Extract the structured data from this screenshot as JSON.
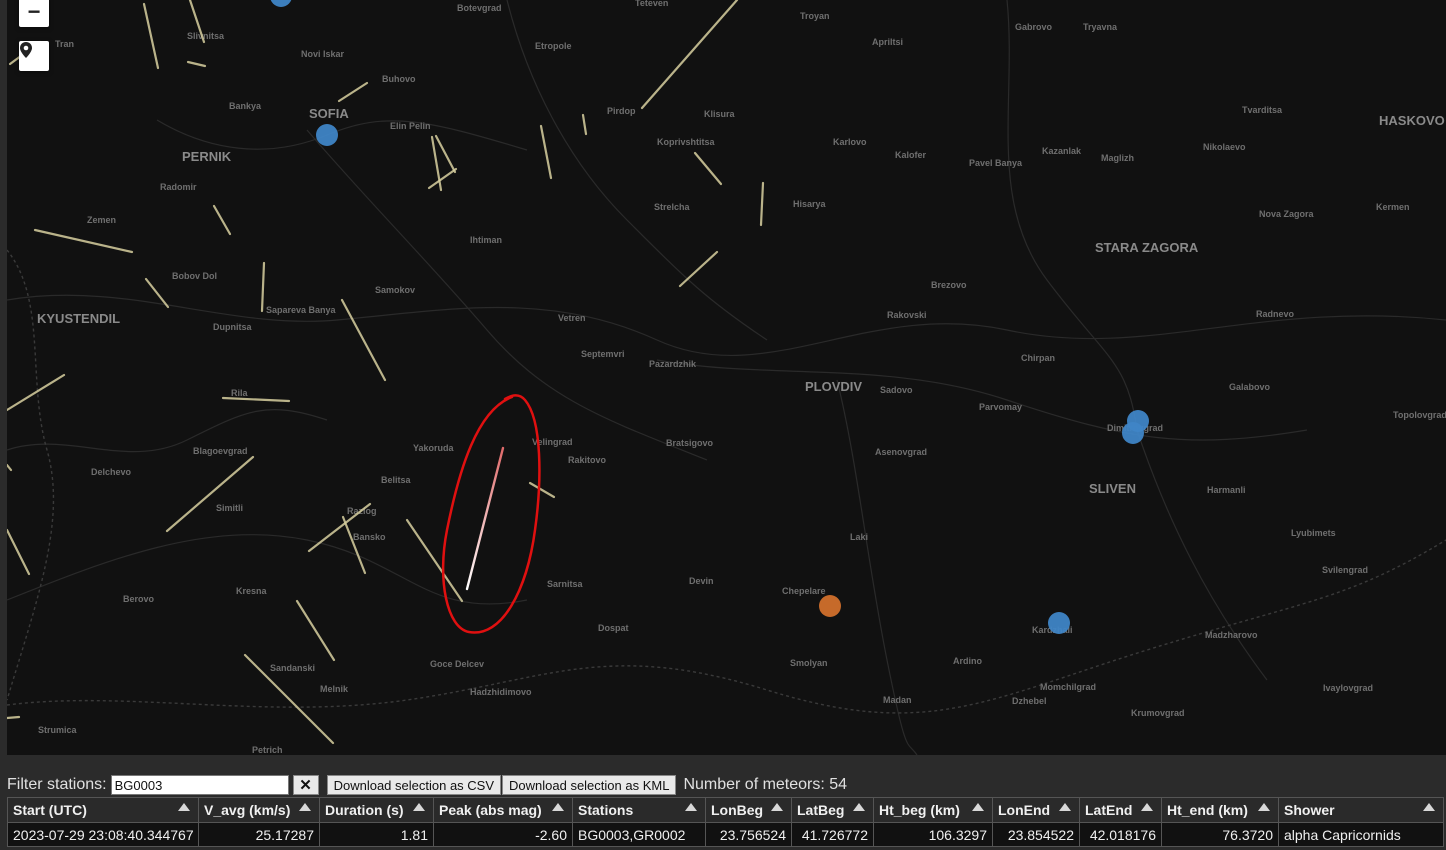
{
  "map": {
    "labels_big": [
      {
        "text": "SOFIA"
      },
      {
        "text": "KYUSTENDIL"
      },
      {
        "text": "PERNIK"
      },
      {
        "text": "PLOVDIV"
      },
      {
        "text": "STARA ZAGORA"
      },
      {
        "text": "HASKOVO"
      },
      {
        "text": "SLIVEN"
      }
    ],
    "labels_small": [
      "Botevgrad",
      "Teteven",
      "Troyan",
      "Gabrovo",
      "Tryavna",
      "Apriltsi",
      "Etropole",
      "Novi Iskar",
      "Buhovo",
      "Bankya",
      "Elin Pelin",
      "Pirdop",
      "Klisura",
      "Koprivshtitsa",
      "Karlovo",
      "Kalofer",
      "Pavel Banya",
      "Kazanlak",
      "Maglizh",
      "Nikolaevo",
      "Tvarditsa",
      "Radomir",
      "Zemen",
      "Strelcha",
      "Hisarya",
      "Nova Zagora",
      "Kermen",
      "Ihtiman",
      "Bobov Dol",
      "Samokov",
      "Brezovo",
      "Sapareva Banya",
      "Dupnitsa",
      "Vetren",
      "Rakovski",
      "Radnevo",
      "Septemvri",
      "Pazardzhik",
      "Chirpan",
      "Rila",
      "Sadovo",
      "Parvomay",
      "Galabovo",
      "Topolovgrad",
      "Yakoruda",
      "Velingrad",
      "Bratsigovo",
      "Asenovgrad",
      "Dimitrovgrad",
      "Delchevo",
      "Blagoevgrad",
      "Rakitovo",
      "Belitsa",
      "Harmanli",
      "Simitli",
      "Razlog",
      "Bansko",
      "Laki",
      "Lyubimets",
      "Svilengrad",
      "Kresna",
      "Sarnitsa",
      "Devin",
      "Chepelare",
      "Berovo",
      "Dospat",
      "Kardzhali",
      "Madzharovo",
      "Smolyan",
      "Sandanski",
      "Ardino",
      "Goce Delcev",
      "Momchilgrad",
      "Ivaylovgrad",
      "Melnik",
      "Hadzhidimovo",
      "Madan",
      "Dzhebel",
      "Krumovgrad",
      "Strumica",
      "Petrich",
      "Tran",
      "Slivnitsa"
    ],
    "station_colors": {
      "network": "#3f85c6",
      "selected": "#c66a2a"
    },
    "meteor_color": "#d8d0a0",
    "highlight_color": "#e01010"
  },
  "controls": {
    "zoom_out": "−"
  },
  "filter": {
    "label": "Filter stations:",
    "value": "BG0003",
    "clear": "✕",
    "csv_button": "Download selection as CSV",
    "kml_button": "Download selection as KML",
    "count_text": "Number of meteors: 54"
  },
  "table": {
    "columns": [
      "Start (UTC)",
      "V_avg (km/s)",
      "Duration (s)",
      "Peak (abs mag)",
      "Stations",
      "LonBeg",
      "LatBeg",
      "Ht_beg (km)",
      "LonEnd",
      "LatEnd",
      "Ht_end (km)",
      "Shower"
    ],
    "rows": [
      [
        "2023-07-29 23:08:40.344767",
        "25.17287",
        "1.81",
        "-2.60",
        "BG0003,GR0002",
        "23.756524",
        "41.726772",
        "106.3297",
        "23.854522",
        "42.018176",
        "76.3720",
        "alpha Capricornids"
      ]
    ]
  }
}
